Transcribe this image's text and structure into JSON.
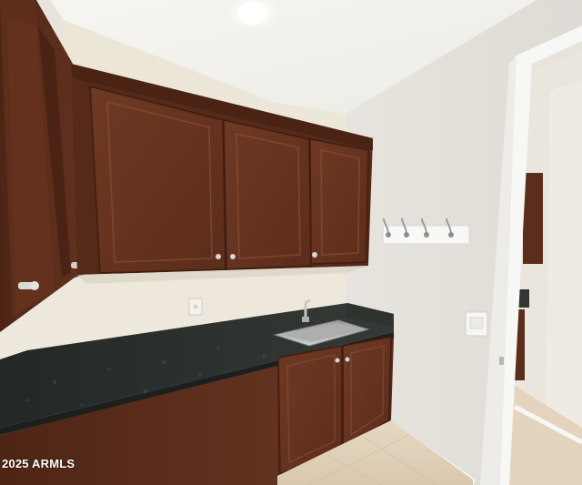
{
  "watermark": {
    "text": "2025 ARMLS"
  },
  "colors": {
    "ceiling": "#f3f1ec",
    "wall_left": "#ebe6da",
    "wall_right": "#e6e3de",
    "cabinet": "#5a2c1a",
    "cabinet_panel": "#6b3621",
    "countertop": "#2b2f2c",
    "floor": "#e2d3bd",
    "sink": "#b8b8b8",
    "door_trim": "#f7f7f5"
  }
}
